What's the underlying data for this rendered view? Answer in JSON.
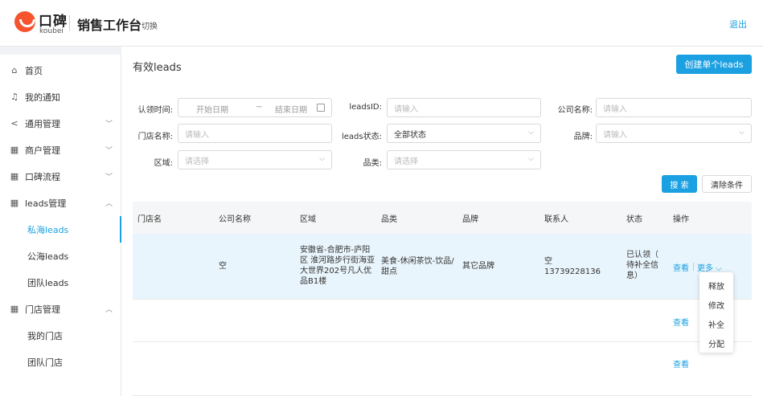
{
  "header": {
    "logo_cn": "口碑",
    "logo_en": "koubei",
    "app_title": "销售工作台",
    "switch_label": "切换",
    "logout_label": "退出"
  },
  "sidebar": {
    "items": [
      {
        "label": "首页",
        "icon": "home-icon",
        "glyph": "⌂"
      },
      {
        "label": "我的通知",
        "icon": "bell-icon",
        "glyph": "♫"
      },
      {
        "label": "通用管理",
        "icon": "share-icon",
        "glyph": "<",
        "chevron": "﹀"
      },
      {
        "label": "商户管理",
        "icon": "grid-icon",
        "glyph": "▦",
        "chevron": "﹀"
      },
      {
        "label": "口碑流程",
        "icon": "grid-icon",
        "glyph": "▦",
        "chevron": "﹀"
      },
      {
        "label": "leads管理",
        "icon": "grid-icon",
        "glyph": "▦",
        "chevron": "︿"
      },
      {
        "label": "私海leads"
      },
      {
        "label": "公海leads"
      },
      {
        "label": "团队leads"
      },
      {
        "label": "门店管理",
        "icon": "grid-icon",
        "glyph": "▦",
        "chevron": "︿"
      },
      {
        "label": "我的门店"
      },
      {
        "label": "团队门店"
      }
    ]
  },
  "main": {
    "title": "有效leads",
    "create_button": "创建单个leads"
  },
  "filters": {
    "claim_time_label": "认领时间:",
    "start_date_placeholder": "开始日期",
    "range_sep": "~",
    "end_date_placeholder": "结束日期",
    "leads_id_label": "leadsID:",
    "leads_id_placeholder": "请输入",
    "company_label": "公司名称:",
    "company_placeholder": "请输入",
    "store_label": "门店名称:",
    "store_placeholder": "请输入",
    "status_label": "leads状态:",
    "status_value": "全部状态",
    "brand_label": "品牌:",
    "brand_placeholder": "请输入",
    "area_label": "区域:",
    "area_placeholder": "请选择",
    "category_label": "品类:",
    "category_placeholder": "请选择",
    "search_button": "搜 索",
    "clear_button": "清除条件"
  },
  "table": {
    "columns": [
      "门店名",
      "公司名称",
      "区域",
      "品类",
      "品牌",
      "联系人",
      "状态",
      "操作"
    ],
    "rows": [
      {
        "store": "",
        "company": "空",
        "area": [
          "安徽省-合肥市-庐阳",
          "区 淮河路步行街海亚",
          "大世界202号凡人优",
          "品B1楼"
        ],
        "category": [
          "美食-休闲茶饮-饮品/",
          "甜点"
        ],
        "brand": "其它品牌",
        "contact": [
          "空",
          "13739228136"
        ],
        "status": [
          "已认领（",
          "待补全信",
          "息）"
        ],
        "view": "查看",
        "more": "更多 ⌵"
      },
      {
        "view": "查看"
      },
      {
        "view": "查看"
      }
    ]
  },
  "more_menu": [
    "释放",
    "修改",
    "补全",
    "分配"
  ],
  "colors": {
    "accent": "#1ba0e1",
    "brand": "#f5542e",
    "row_highlight": "#e9f5fc"
  }
}
